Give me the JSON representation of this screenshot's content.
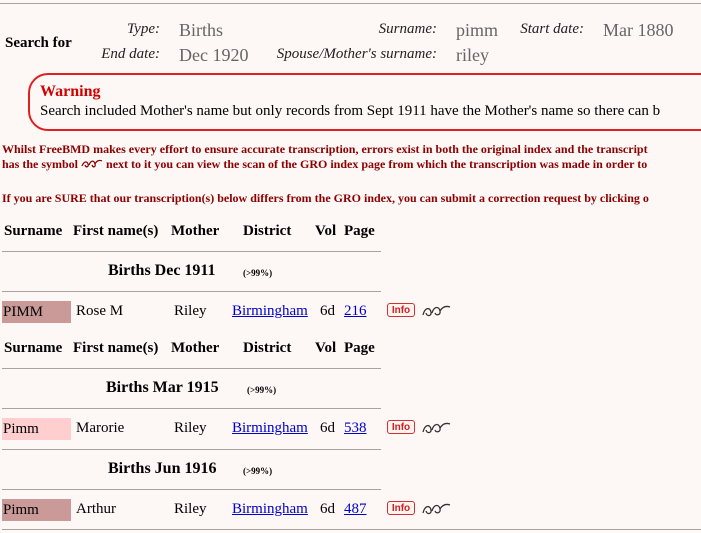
{
  "search": {
    "heading": "Search for",
    "type_label": "Type:",
    "type_value": "Births",
    "surname_label": "Surname:",
    "surname_value": "pimm",
    "start_label": "Start date:",
    "start_value": "Mar 1880",
    "end_label": "End date:",
    "end_value": "Dec 1920",
    "spouse_label": "Spouse/Mother's surname:",
    "spouse_value": "riley"
  },
  "warning": {
    "title": "Warning",
    "text": "Search included Mother's name but only records from Sept 1911 have the Mother's name so there can b"
  },
  "notices": {
    "line1": "Whilst FreeBMD makes every effort to ensure accurate transcription, errors exist in both the original index and the transcript",
    "line2_pre": "has the symbol",
    "line2_post": "next to it you can view the scan of the GRO index page from which the transcription was made in order to",
    "line3": "If you are SURE that our transcription(s) below differs from the GRO index, you can submit a correction request by clicking o"
  },
  "table": {
    "headers": {
      "surname": "Surname",
      "first": "First name(s)",
      "mother": "Mother",
      "district": "District",
      "vol": "Vol",
      "page": "Page"
    },
    "sections": [
      {
        "title": "Births Dec 1911",
        "accuracy": "(>99%)"
      },
      {
        "title": "Births Mar 1915",
        "accuracy": "(>99%)"
      },
      {
        "title": "Births Jun 1916",
        "accuracy": "(>99%)"
      }
    ],
    "rows": [
      {
        "surname": "PIMM",
        "first": "Rose M",
        "mother": "Riley",
        "district": "Birmingham",
        "vol": "6d",
        "page": "216",
        "info": "Info"
      },
      {
        "surname": "Pimm",
        "first": "Marorie",
        "mother": "Riley",
        "district": "Birmingham",
        "vol": "6d",
        "page": "538",
        "info": "Info"
      },
      {
        "surname": "Pimm",
        "first": "Arthur",
        "mother": "Riley",
        "district": "Birmingham",
        "vol": "6d",
        "page": "487",
        "info": "Info"
      }
    ]
  },
  "colors": {
    "surname_dark": "#c99a97",
    "surname_light": "#ffcfcf",
    "warning_border": "#e02020",
    "notice_text": "#8b0000",
    "link": "#0000cc"
  }
}
